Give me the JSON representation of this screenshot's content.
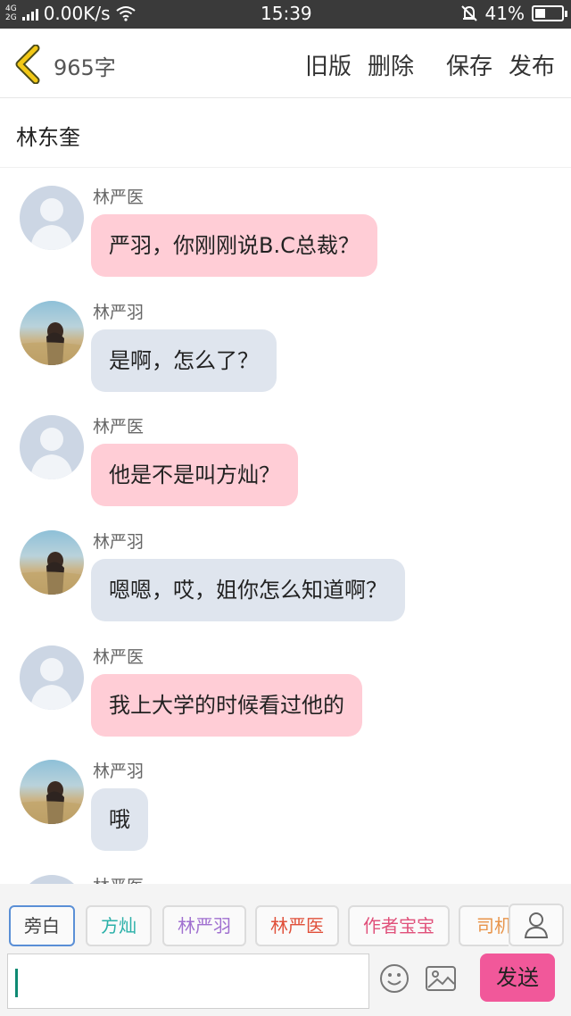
{
  "status_bar": {
    "network": "4G 2G",
    "speed": "0.00K/s",
    "time": "15:39",
    "battery": "41%",
    "battery_level": 0.41
  },
  "header": {
    "word_count": "965字",
    "old_version": "旧版",
    "delete": "删除",
    "save": "保存",
    "publish": "发布"
  },
  "chapter_title": "林东奎",
  "messages": [
    {
      "sender": "林严医",
      "text": "严羽，你刚刚说B.C总裁？",
      "avatar": "default-avatar",
      "side": "pink"
    },
    {
      "sender": "林严羽",
      "text": "是啊，怎么了？",
      "avatar": "photo-avatar",
      "side": "blue"
    },
    {
      "sender": "林严医",
      "text": "他是不是叫方灿？",
      "avatar": "default-avatar",
      "side": "pink"
    },
    {
      "sender": "林严羽",
      "text": "嗯嗯，哎，姐你怎么知道啊？",
      "avatar": "photo-avatar",
      "side": "blue"
    },
    {
      "sender": "林严医",
      "text": "我上大学的时候看过他的",
      "avatar": "default-avatar",
      "side": "pink"
    },
    {
      "sender": "林严羽",
      "text": "哦",
      "avatar": "photo-avatar",
      "side": "blue"
    },
    {
      "sender": "林严医",
      "text": "",
      "avatar": "default-avatar",
      "side": "pink"
    }
  ],
  "characters": [
    {
      "label": "旁白",
      "color": "#444444"
    },
    {
      "label": "方灿",
      "color": "#2ab0a8"
    },
    {
      "label": "林严羽",
      "color": "#a070d0"
    },
    {
      "label": "林严医",
      "color": "#e0503a"
    },
    {
      "label": "作者宝宝",
      "color": "#e0507a"
    },
    {
      "label": "司机",
      "color": "#e8944a"
    }
  ],
  "input": {
    "value": "",
    "placeholder": ""
  },
  "send_label": "发送",
  "colors": {
    "accent_pink": "#f1589a",
    "bubble_pink": "#ffcdd6",
    "bubble_blue": "#dfe5ee"
  },
  "icons": [
    "back-chevron-icon",
    "emoji-icon",
    "image-icon",
    "user-icon"
  ]
}
